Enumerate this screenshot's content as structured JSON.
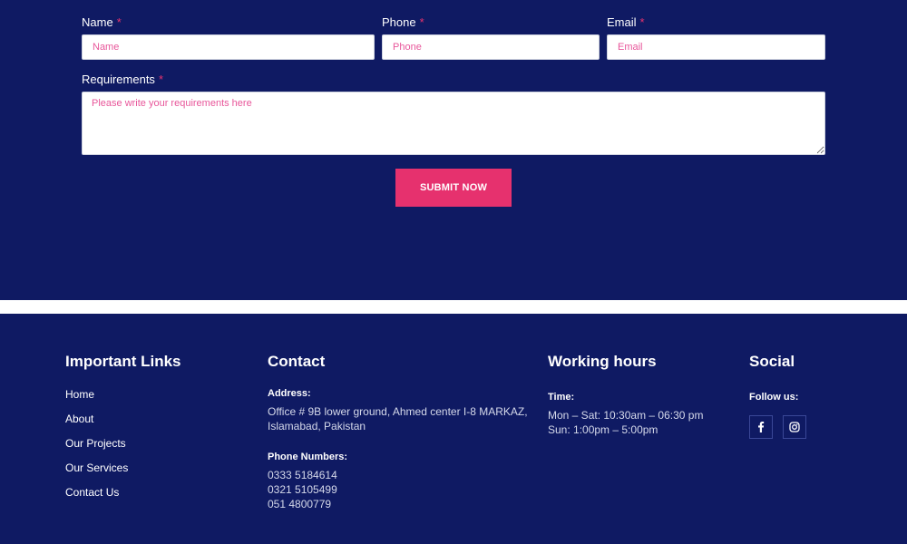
{
  "form": {
    "name_label": "Name",
    "name_placeholder": "Name",
    "phone_label": "Phone",
    "phone_placeholder": "Phone",
    "email_label": "Email",
    "email_placeholder": "Email",
    "requirements_label": "Requirements",
    "requirements_placeholder": "Please write your requirements here",
    "required_mark": "*",
    "submit_label": "SUBMIT NOW"
  },
  "footer": {
    "links": {
      "title": "Important Links",
      "items": [
        "Home",
        "About",
        "Our Projects",
        "Our Services",
        "Contact Us"
      ]
    },
    "contact": {
      "title": "Contact",
      "address_label": "Address:",
      "address_line1": "Office # 9B lower ground, Ahmed center I-8 MARKAZ,",
      "address_line2": "Islamabad, Pakistan",
      "phone_label": "Phone Numbers:",
      "phones": [
        "0333 5184614",
        "0321 5105499",
        "051 4800779"
      ]
    },
    "hours": {
      "title": "Working hours",
      "time_label": "Time:",
      "line1": "Mon – Sat: 10:30am – 06:30 pm",
      "line2": "Sun: 1:00pm – 5:00pm"
    },
    "social": {
      "title": "Social",
      "follow_label": "Follow us:",
      "icons": [
        "facebook-icon",
        "instagram-icon"
      ]
    }
  },
  "colors": {
    "background": "#0f1a63",
    "accent": "#e6316e",
    "placeholder": "#e8569a"
  }
}
